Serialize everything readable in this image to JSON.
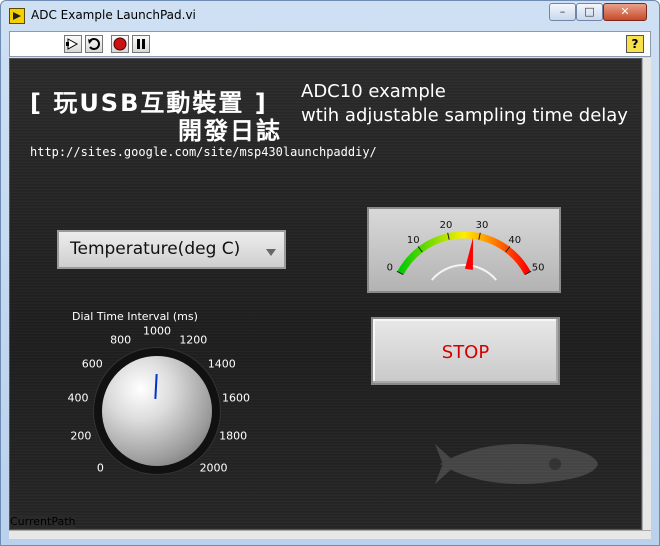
{
  "window": {
    "title": "ADC Example LaunchPad.vi",
    "min_symbol": "–",
    "max_symbol": "□",
    "close_symbol": "✕"
  },
  "toolbar": {
    "run_icon": "run-arrow-icon",
    "run_continuous_icon": "run-continuously-icon",
    "abort_icon": "abort-icon",
    "pause_icon": "pause-icon",
    "help_label": "?"
  },
  "panel": {
    "cjk_line1": "[ 玩USB互動裝置 ]",
    "cjk_line2": "開發日誌",
    "adc_title": "ADC10 example",
    "adc_subtitle": "wtih adjustable sampling time delay",
    "url": "http://sites.google.com/site/msp430launchpaddiy/",
    "current_path": "CurrentPath"
  },
  "ring": {
    "selected": "Temperature(deg C)"
  },
  "dial": {
    "label": "Dial Time Interval (ms)",
    "ticks": [
      "0",
      "200",
      "400",
      "600",
      "800",
      "1000",
      "1200",
      "1400",
      "1600",
      "1800",
      "2000"
    ],
    "value": 1000
  },
  "gauge": {
    "ticks": [
      "0",
      "10",
      "20",
      "30",
      "40",
      "50"
    ],
    "min": 0,
    "max": 50,
    "value": 28,
    "colors": {
      "low": "#00cc00",
      "mid": "#ffee00",
      "high": "#ff0000",
      "needle": "#ff0000"
    }
  },
  "stop": {
    "label": "STOP",
    "color": "#d40000"
  }
}
